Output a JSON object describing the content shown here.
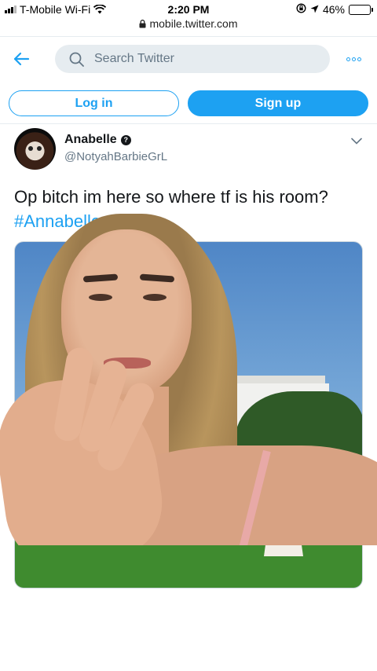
{
  "status_bar": {
    "carrier": "T-Mobile Wi-Fi",
    "time": "2:20 PM",
    "battery": "46%",
    "battery_level": 0.46
  },
  "browser": {
    "url": "mobile.twitter.com"
  },
  "header": {
    "search_placeholder": "Search Twitter"
  },
  "auth": {
    "login_label": "Log in",
    "signup_label": "Sign up"
  },
  "tweet": {
    "author_name": "Anabelle",
    "author_handle": "@NotyahBarbieGrL",
    "text": "Op bitch im here so where tf is his room?",
    "hashtag": "#Annabelle"
  },
  "colors": {
    "accent": "#1da1f2",
    "text": "#14171a",
    "muted": "#657786"
  }
}
